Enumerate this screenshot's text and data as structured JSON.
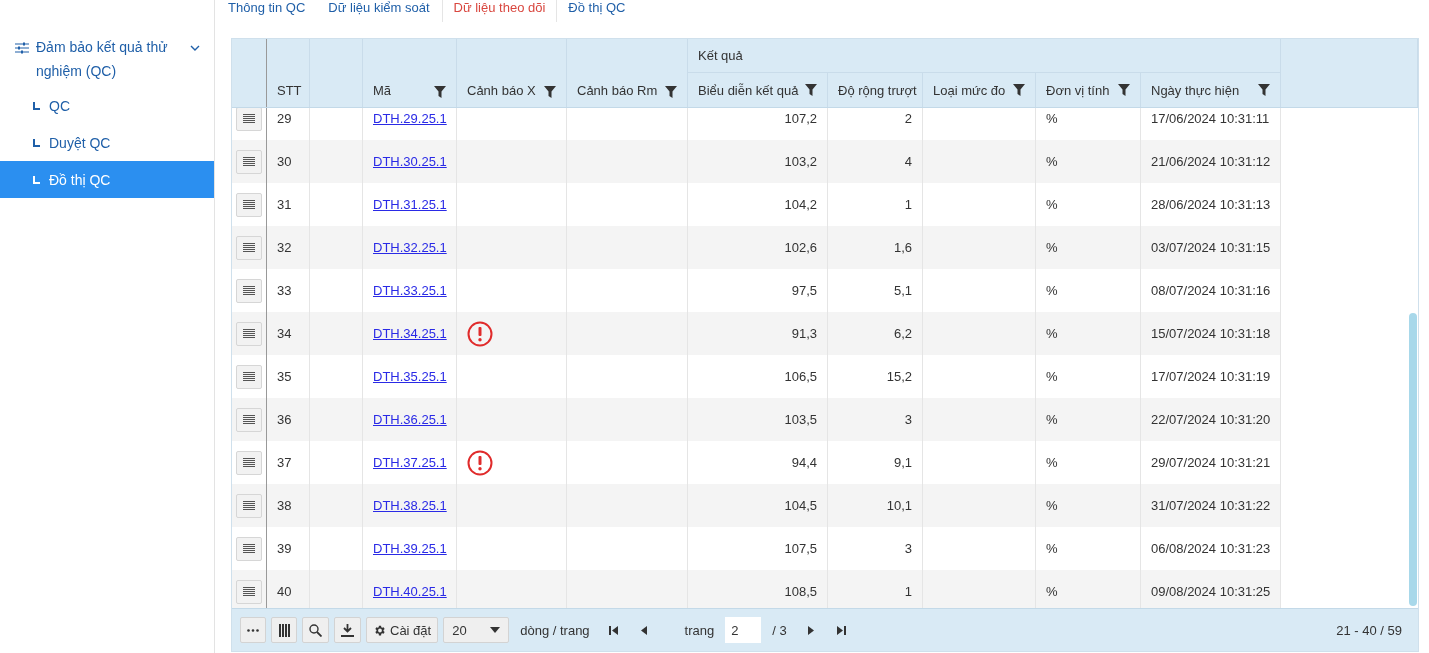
{
  "sidebar": {
    "group": {
      "label": "Đảm bảo kết quả thử nghiệm (QC)",
      "expanded": true,
      "children": [
        {
          "label": "QC",
          "selected": false
        },
        {
          "label": "Duyệt QC",
          "selected": false
        },
        {
          "label": "Đồ thị QC",
          "selected": true
        }
      ]
    }
  },
  "tabs": [
    {
      "label": "Thông tin QC",
      "selected": false
    },
    {
      "label": "Dữ liệu kiểm soát",
      "selected": false
    },
    {
      "label": "Dữ liệu theo dõi",
      "selected": true
    },
    {
      "label": "Đồ thị QC",
      "selected": false
    }
  ],
  "table": {
    "group_header": "Kết quả",
    "columns": [
      {
        "label": "STT",
        "filter": false
      },
      {
        "label": "Mã",
        "filter": true
      },
      {
        "label": "Cảnh báo X",
        "filter": true
      },
      {
        "label": "Cảnh báo Rm",
        "filter": true
      },
      {
        "label": "Biểu diễn kết quả",
        "filter": true
      },
      {
        "label": "Độ rộng trượt",
        "filter": false
      },
      {
        "label": "Loại mức đo",
        "filter": true
      },
      {
        "label": "Đơn vị tính",
        "filter": true
      },
      {
        "label": "Ngày thực hiện",
        "filter": true
      }
    ],
    "rows": [
      {
        "stt": "29",
        "code": "DTH.29.25.1",
        "warning_x": false,
        "result": "107,2",
        "range": "2",
        "unit": "%",
        "date": "17/06/2024 10:31:11"
      },
      {
        "stt": "30",
        "code": "DTH.30.25.1",
        "warning_x": false,
        "result": "103,2",
        "range": "4",
        "unit": "%",
        "date": "21/06/2024 10:31:12"
      },
      {
        "stt": "31",
        "code": "DTH.31.25.1",
        "warning_x": false,
        "result": "104,2",
        "range": "1",
        "unit": "%",
        "date": "28/06/2024 10:31:13"
      },
      {
        "stt": "32",
        "code": "DTH.32.25.1",
        "warning_x": false,
        "result": "102,6",
        "range": "1,6",
        "unit": "%",
        "date": "03/07/2024 10:31:15"
      },
      {
        "stt": "33",
        "code": "DTH.33.25.1",
        "warning_x": false,
        "result": "97,5",
        "range": "5,1",
        "unit": "%",
        "date": "08/07/2024 10:31:16"
      },
      {
        "stt": "34",
        "code": "DTH.34.25.1",
        "warning_x": true,
        "result": "91,3",
        "range": "6,2",
        "unit": "%",
        "date": "15/07/2024 10:31:18"
      },
      {
        "stt": "35",
        "code": "DTH.35.25.1",
        "warning_x": false,
        "result": "106,5",
        "range": "15,2",
        "unit": "%",
        "date": "17/07/2024 10:31:19"
      },
      {
        "stt": "36",
        "code": "DTH.36.25.1",
        "warning_x": false,
        "result": "103,5",
        "range": "3",
        "unit": "%",
        "date": "22/07/2024 10:31:20"
      },
      {
        "stt": "37",
        "code": "DTH.37.25.1",
        "warning_x": true,
        "result": "94,4",
        "range": "9,1",
        "unit": "%",
        "date": "29/07/2024 10:31:21"
      },
      {
        "stt": "38",
        "code": "DTH.38.25.1",
        "warning_x": false,
        "result": "104,5",
        "range": "10,1",
        "unit": "%",
        "date": "31/07/2024 10:31:22"
      },
      {
        "stt": "39",
        "code": "DTH.39.25.1",
        "warning_x": false,
        "result": "107,5",
        "range": "3",
        "unit": "%",
        "date": "06/08/2024 10:31:23"
      },
      {
        "stt": "40",
        "code": "DTH.40.25.1",
        "warning_x": false,
        "result": "108,5",
        "range": "1",
        "unit": "%",
        "date": "09/08/2024 10:31:25"
      }
    ]
  },
  "footer": {
    "settings_label": "Cài đặt",
    "page_size": "20",
    "page_size_label": "dòng / trang",
    "page_label": "trang",
    "page": "2",
    "page_total": "/ 3",
    "range_summary": "21 - 40 / 59"
  }
}
